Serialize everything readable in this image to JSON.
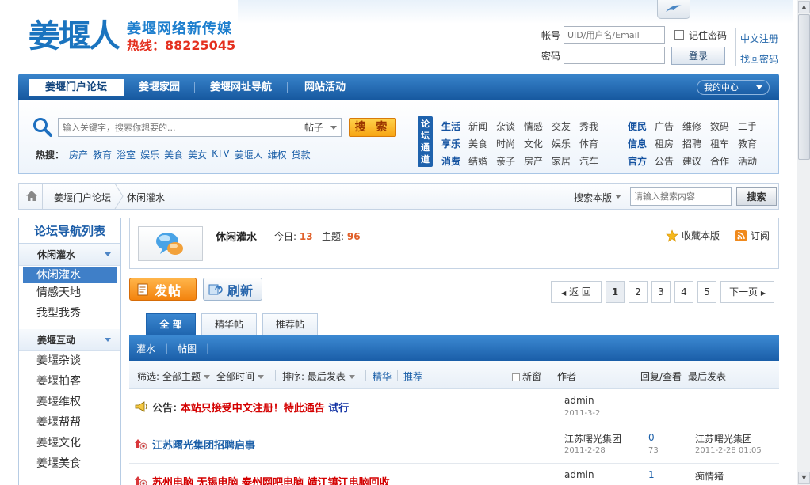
{
  "header": {
    "logo_text": "姜堰人",
    "slogan": "姜堰网络新传媒",
    "hotline_label": "热线：",
    "hotline_number": "88225045"
  },
  "login": {
    "account_label": "帐号",
    "account_placeholder": "UID/用户名/Email",
    "password_label": "密码",
    "remember_label": "记住密码",
    "login_button": "登录",
    "register_link": "中文注册",
    "recover_link": "找回密码"
  },
  "mainnav": {
    "items": [
      "姜堰门户论坛",
      "姜堰家园",
      "姜堰网址导航",
      "网站活动"
    ],
    "my_center": "我的中心"
  },
  "search": {
    "placeholder": "输入关键字，搜索你想要的...",
    "type": "帖子",
    "button": "搜 索",
    "hot_label": "热搜：",
    "hot": [
      "房产",
      "教育",
      "浴室",
      "娱乐",
      "美食",
      "美女",
      "KTV",
      "姜堰人",
      "维权",
      "贷款"
    ]
  },
  "channels": {
    "badge": "论坛通道",
    "left": [
      {
        "key": "生活",
        "items": [
          "新闻",
          "杂谈",
          "情感",
          "交友",
          "秀我"
        ]
      },
      {
        "key": "享乐",
        "items": [
          "美食",
          "时尚",
          "文化",
          "娱乐",
          "体育"
        ]
      },
      {
        "key": "消费",
        "items": [
          "结婚",
          "亲子",
          "房产",
          "家居",
          "汽车"
        ]
      }
    ],
    "right": [
      {
        "key": "便民",
        "items": [
          "广告",
          "维修",
          "数码",
          "二手"
        ]
      },
      {
        "key": "信息",
        "items": [
          "租房",
          "招聘",
          "租车",
          "教育"
        ]
      },
      {
        "key": "官方",
        "items": [
          "公告",
          "建议",
          "合作",
          "活动"
        ]
      }
    ]
  },
  "breadcrumb": {
    "level1": "姜堰门户论坛",
    "level2": "休闲灌水",
    "search_scope": "搜索本版",
    "search_placeholder": "请输入搜索内容",
    "search_button": "搜索"
  },
  "sidebar": {
    "title": "论坛导航列表",
    "groups": [
      {
        "name": "休闲灌水",
        "items": [
          "休闲灌水",
          "情感天地",
          "我型我秀"
        ]
      },
      {
        "name": "姜堰互动",
        "items": [
          "姜堰杂谈",
          "姜堰拍客",
          "姜堰维权",
          "姜堰帮帮",
          "姜堰文化",
          "姜堰美食"
        ]
      }
    ]
  },
  "forum": {
    "name": "休闲灌水",
    "today_label": "今日:",
    "today_count": "13",
    "topics_label": "主题:",
    "topics_count": "96",
    "favorite": "收藏本版",
    "subscribe": "订阅"
  },
  "actions": {
    "post": "发帖",
    "refresh": "刷新"
  },
  "pager": {
    "prev": "返 回",
    "pages": [
      "1",
      "2",
      "3",
      "4",
      "5"
    ],
    "current": "1",
    "next": "下一页"
  },
  "tabs": [
    "全 部",
    "精华帖",
    "推荐帖"
  ],
  "categories": [
    "灌水",
    "帖图"
  ],
  "filter": {
    "label": "筛选:",
    "topic": "全部主题",
    "time": "全部时间",
    "sort": "排序: 最后发表",
    "digest": "精华",
    "recommend": "推荐",
    "new_window": "新窗",
    "col_author": "作者",
    "col_reply": "回复/查看",
    "col_last": "最后发表"
  },
  "threads": [
    {
      "prefix": "公告: ",
      "title": "本站只接受中文注册！特此通告",
      "tag": "试行",
      "author": "admin",
      "date": "2011-3-2",
      "replies": "",
      "views": "",
      "last_user": "",
      "last_date": ""
    },
    {
      "prefix": "",
      "title": "江苏曙光集团招聘启事",
      "tag": "",
      "author": "江苏曙光集团",
      "date": "2011-2-28",
      "replies": "0",
      "views": "73",
      "last_user": "江苏曙光集团",
      "last_date": "2011-2-28 01:05"
    },
    {
      "prefix": "",
      "title": "苏州电脑 无锡电脑 泰州网吧电脑 靖江镇江电脑回收",
      "tag": "",
      "author": "admin",
      "date": "",
      "replies": "1",
      "views": "",
      "last_user": "痴情猪",
      "last_date": ""
    }
  ],
  "colors": {
    "brand_blue": "#1b74bf",
    "nav_blue": "#1d63ad",
    "hotline_red": "#e4301f",
    "post_orange": "#f3830e",
    "notice_red": "#d40000"
  }
}
